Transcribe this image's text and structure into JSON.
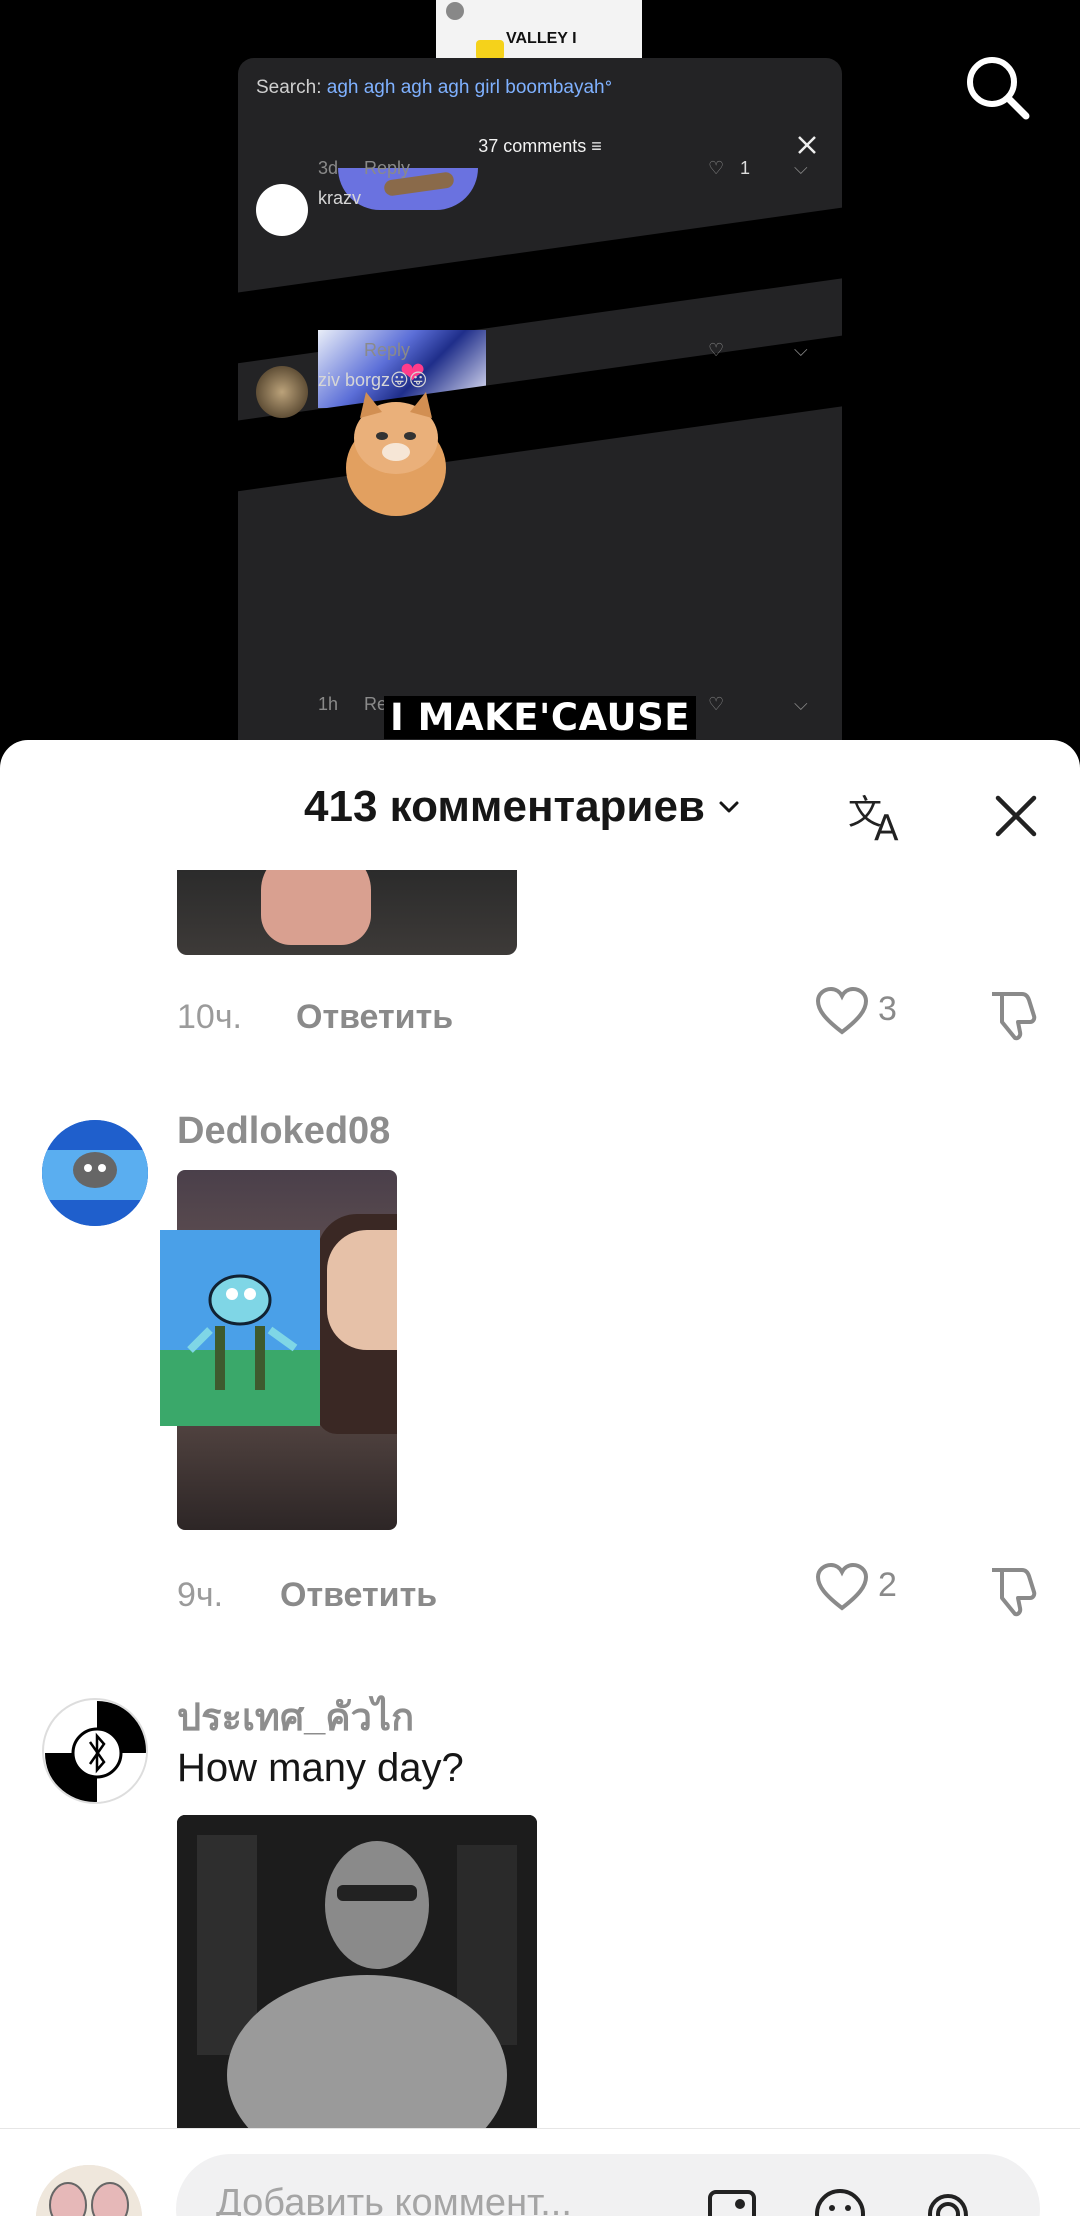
{
  "video": {
    "inner_panel": {
      "search_prefix": "Search: ",
      "search_query": "agh agh agh agh girl boombayah",
      "comments_count": "37 comments",
      "comments": [
        {
          "time": "3d",
          "reply": "Reply",
          "likes": "1"
        },
        {
          "user": "krazv",
          "reply": "Reply"
        },
        {
          "user": "ziv borgz😛😛",
          "time": "1h",
          "reply": "Rep"
        }
      ]
    },
    "caption": "I MAKE'CAUSE",
    "thumb_text": "VALLEY I"
  },
  "sheet": {
    "title": "413 комментариев",
    "comments": [
      {
        "time": "10ч.",
        "reply": "Ответить",
        "likes": "3"
      },
      {
        "user": "Dedloked08",
        "time": "9ч.",
        "reply": "Ответить",
        "likes": "2"
      },
      {
        "user": "ประเทศ_คัวไก",
        "text": "How many day?"
      }
    ]
  },
  "composer": {
    "placeholder": "Добавить коммент..."
  },
  "colors": {
    "accent_blue": "#7fb1ff",
    "sheet_bg": "#ffffff",
    "panel_bg": "#232325"
  }
}
